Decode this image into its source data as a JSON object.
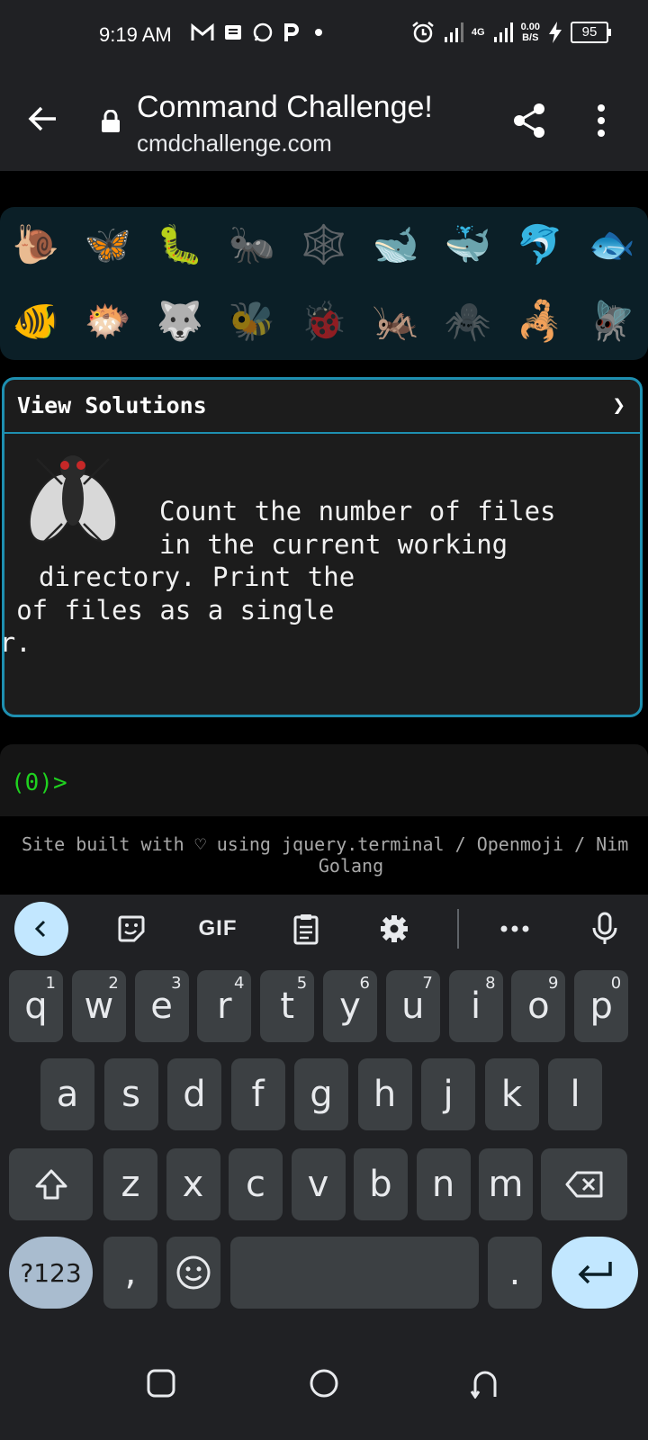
{
  "status_bar": {
    "time": "9:19 AM",
    "network": "4G",
    "net_speed_value": "0.00",
    "net_speed_unit": "B/S",
    "battery": "95",
    "notification_icons": [
      "gmail-icon",
      "message-icon",
      "whatsapp-icon",
      "p-icon",
      "dot-icon"
    ]
  },
  "toolbar": {
    "title": "Command Challenge!",
    "url": "cmdchallenge.com"
  },
  "emoji_panel": {
    "row1": [
      "🐌",
      "🦋",
      "🐛",
      "🐜",
      "🕸️",
      "🐋",
      "🐳",
      "🐬",
      "🐟"
    ],
    "row2": [
      "🐠",
      "🐡",
      "🐺",
      "🐝",
      "🐞",
      "🦗",
      "🕷️",
      "🦂",
      "🪰"
    ]
  },
  "solutions": {
    "header": "View Solutions",
    "chevron": "❯",
    "task_lines": [
      "Count the number of files",
      "in the current working",
      "directory. Print the",
      "number of files as a single",
      "integer."
    ]
  },
  "terminal": {
    "prompt": "(0)>"
  },
  "footer": {
    "line1": "Site built with ♡ using jquery.terminal / Openmoji / Nim",
    "line2": "Golang"
  },
  "keyboard": {
    "gif_label": "GIF",
    "row1": [
      {
        "k": "q",
        "h": "1"
      },
      {
        "k": "w",
        "h": "2"
      },
      {
        "k": "e",
        "h": "3"
      },
      {
        "k": "r",
        "h": "4"
      },
      {
        "k": "t",
        "h": "5"
      },
      {
        "k": "y",
        "h": "6"
      },
      {
        "k": "u",
        "h": "7"
      },
      {
        "k": "i",
        "h": "8"
      },
      {
        "k": "o",
        "h": "9"
      },
      {
        "k": "p",
        "h": "0"
      }
    ],
    "row2": [
      "a",
      "s",
      "d",
      "f",
      "g",
      "h",
      "j",
      "k",
      "l"
    ],
    "row3": [
      "z",
      "x",
      "c",
      "v",
      "b",
      "n",
      "m"
    ],
    "symbols_label": "?123",
    "comma": ",",
    "period": "."
  },
  "colors": {
    "accent": "#1e8fb0",
    "prompt_green": "#1fd11f",
    "key_bg": "#3c4043",
    "chrome_bg": "#202124"
  }
}
